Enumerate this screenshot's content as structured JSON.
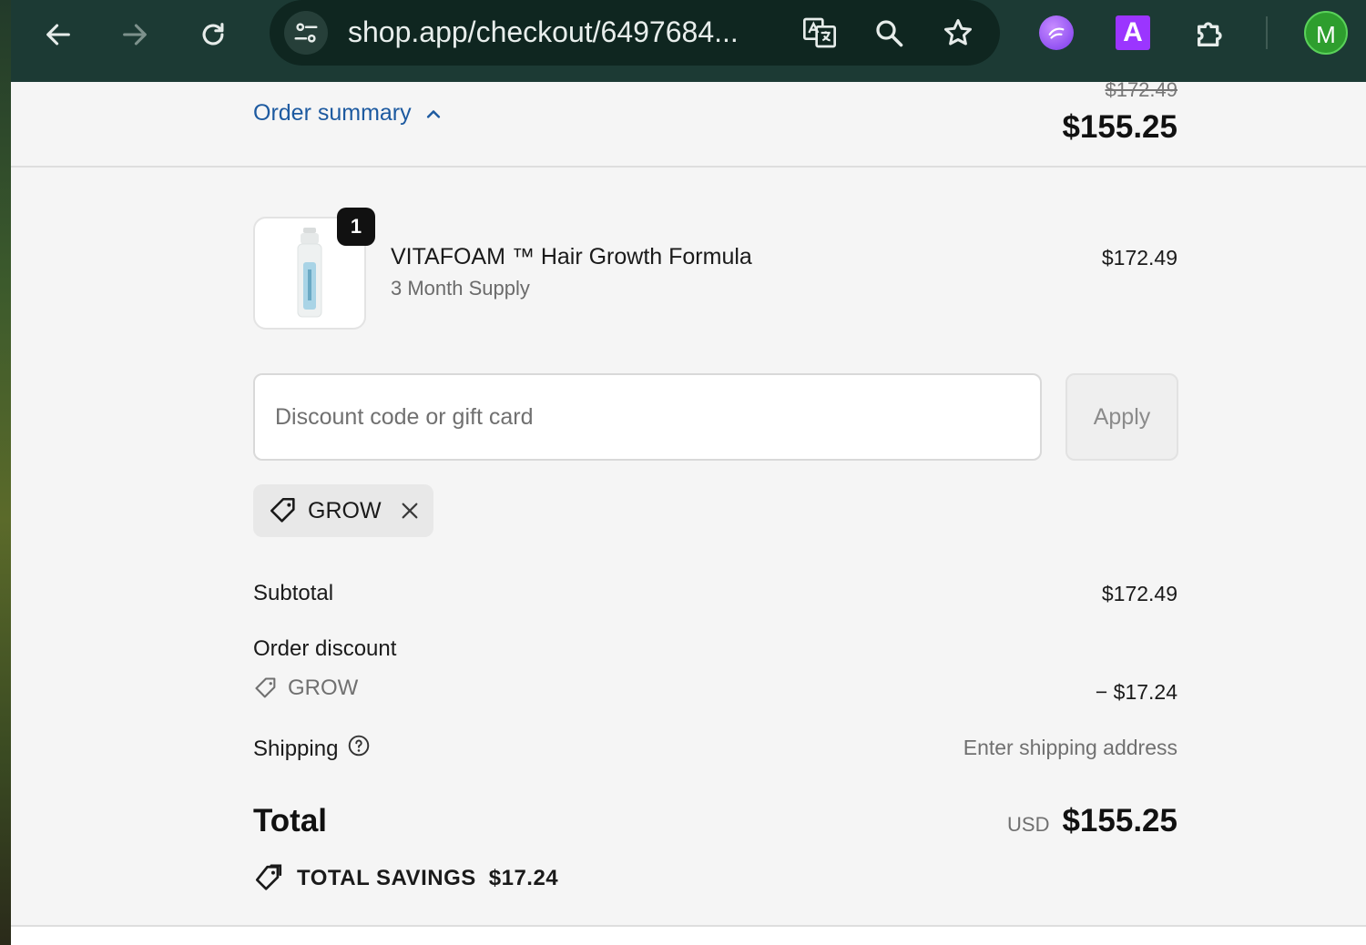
{
  "browser": {
    "url": "shop.app/checkout/6497684...",
    "avatar_letter": "M",
    "ext_letter": "A"
  },
  "summary": {
    "toggle_label": "Order summary",
    "original_price": "$172.49",
    "total": "$155.25"
  },
  "product": {
    "quantity": "1",
    "name": "VITAFOAM ™ Hair Growth Formula",
    "variant": "3 Month Supply",
    "price": "$172.49"
  },
  "discount": {
    "placeholder": "Discount code or gift card",
    "apply_label": "Apply",
    "applied_code": "GROW"
  },
  "totals": {
    "subtotal_label": "Subtotal",
    "subtotal_value": "$172.49",
    "order_discount_label": "Order discount",
    "discount_code": "GROW",
    "discount_value": "− $17.24",
    "shipping_label": "Shipping",
    "shipping_value": "Enter shipping address",
    "total_label": "Total",
    "currency": "USD",
    "total_value": "$155.25",
    "savings_label": "TOTAL SAVINGS",
    "savings_value": "$17.24"
  },
  "colors": {
    "toolbar": "#1c3a34",
    "link": "#1d5aa0",
    "avatar": "#2e9e2e"
  }
}
